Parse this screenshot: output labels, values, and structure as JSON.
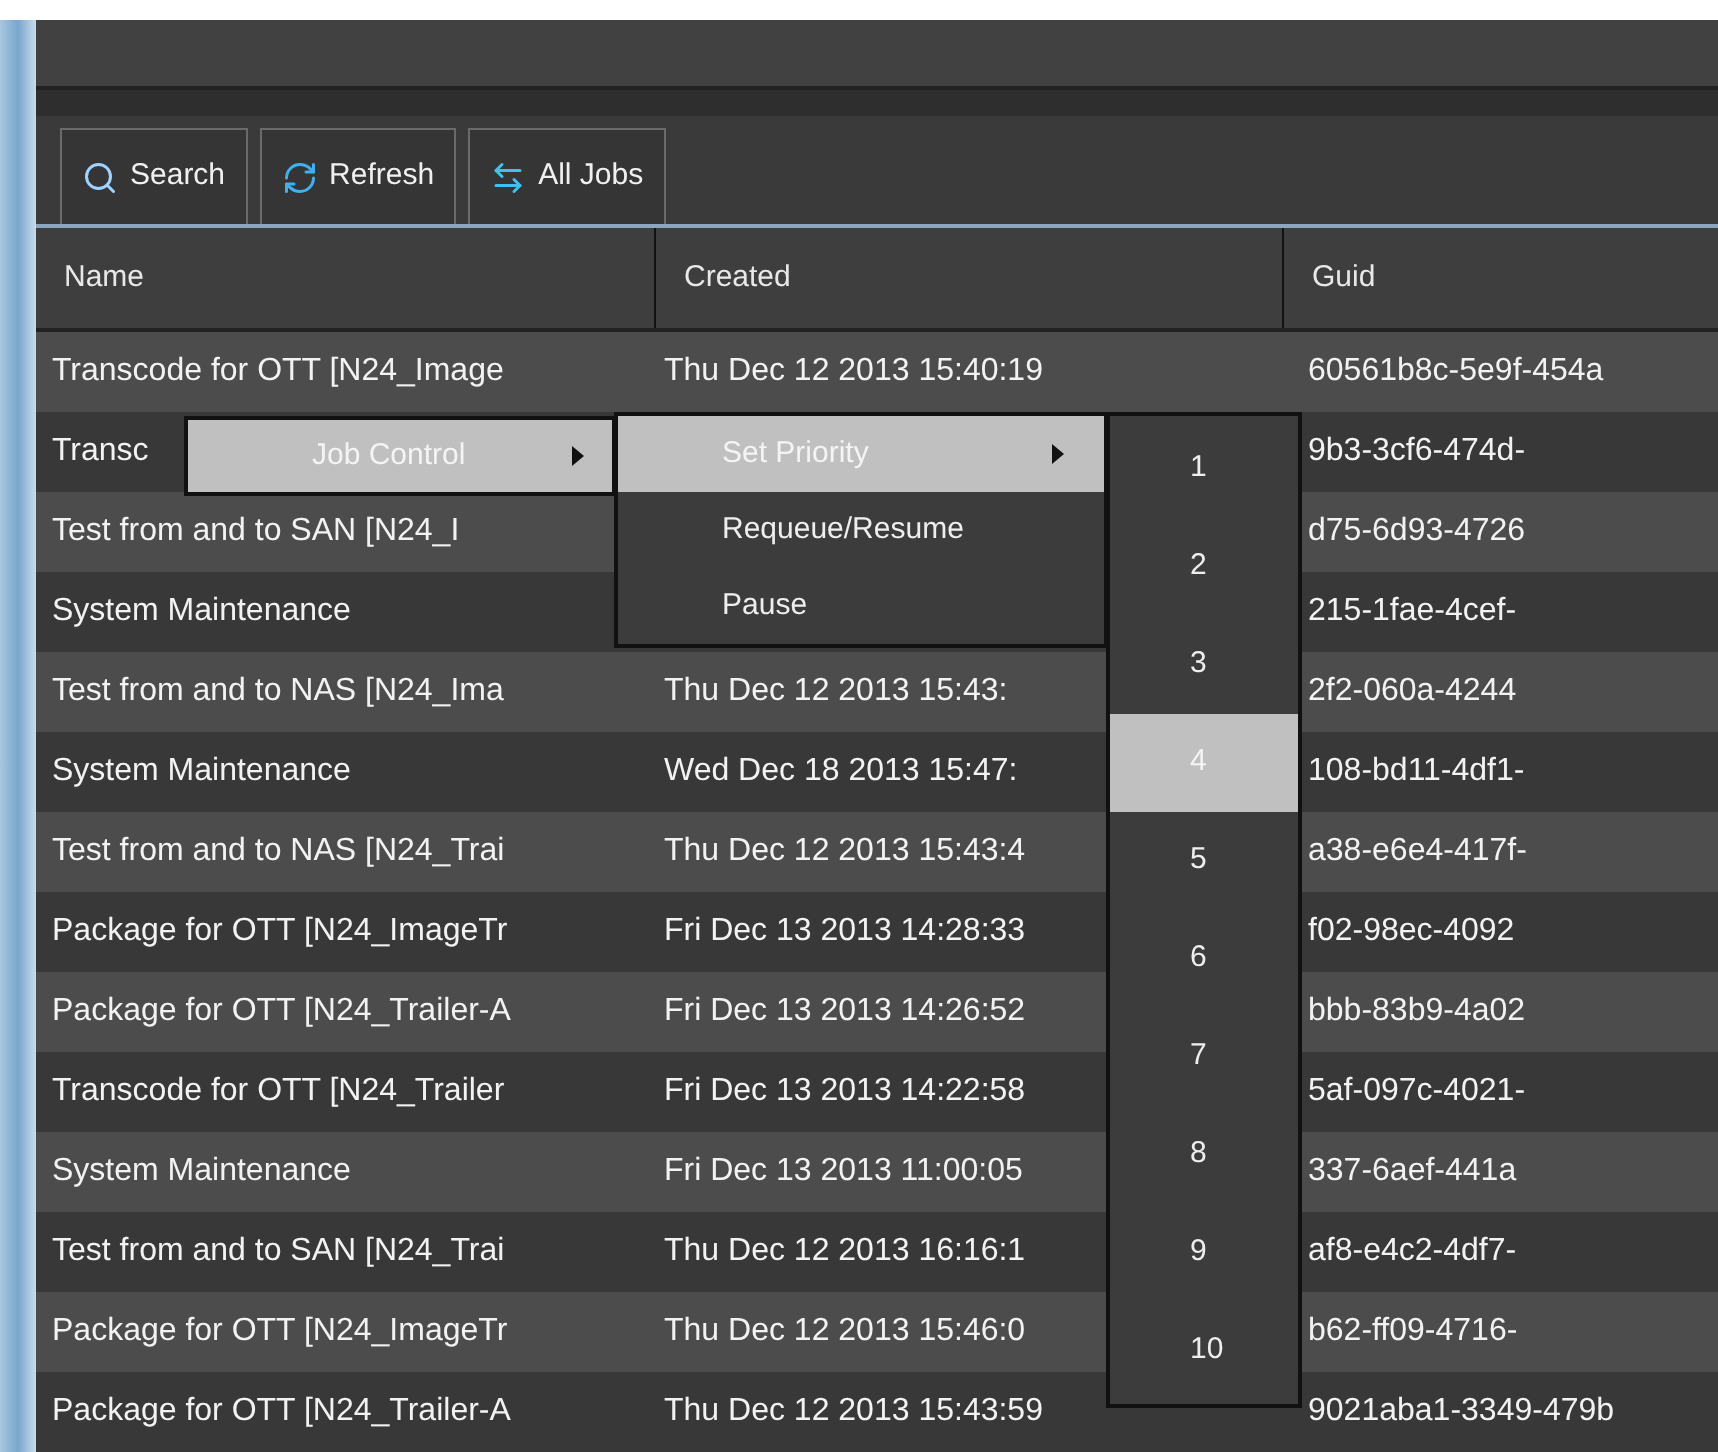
{
  "toolbar": [
    {
      "label": "Search",
      "kind": "search"
    },
    {
      "label": "Refresh",
      "kind": "refresh"
    },
    {
      "label": "All Jobs",
      "kind": "swap"
    }
  ],
  "table": {
    "columns": [
      "Name",
      "Created",
      "Guid"
    ],
    "rows": [
      {
        "name": "Transcode for OTT [N24_Image",
        "created": "Thu Dec 12 2013 15:40:19",
        "guid": "60561b8c-5e9f-454a"
      },
      {
        "name": "Transc",
        "guid": "9b3-3cf6-474d-"
      },
      {
        "name": "Test from and to SAN [N24_I",
        "guid": "d75-6d93-4726"
      },
      {
        "name": "System Maintenance",
        "guid": "215-1fae-4cef-"
      },
      {
        "name": "Test from and to NAS [N24_Ima",
        "created": "Thu Dec 12 2013 15:43:",
        "guid": "2f2-060a-4244"
      },
      {
        "name": "System Maintenance",
        "created": "Wed Dec 18 2013 15:47:",
        "guid": "108-bd11-4df1-"
      },
      {
        "name": "Test from and to NAS [N24_Trai",
        "created": "Thu Dec 12 2013 15:43:4",
        "guid": "a38-e6e4-417f-"
      },
      {
        "name": "Package for OTT [N24_ImageTr",
        "created": "Fri Dec 13 2013 14:28:33",
        "guid": "f02-98ec-4092"
      },
      {
        "name": "Package for OTT [N24_Trailer-A",
        "created": "Fri Dec 13 2013 14:26:52",
        "guid": "bbb-83b9-4a02"
      },
      {
        "name": "Transcode for OTT [N24_Trailer",
        "created": "Fri Dec 13 2013 14:22:58",
        "guid": "5af-097c-4021-"
      },
      {
        "name": "System Maintenance",
        "created": "Fri Dec 13 2013 11:00:05",
        "guid": "337-6aef-441a"
      },
      {
        "name": "Test from and to SAN [N24_Trai",
        "created": "Thu Dec 12 2013 16:16:1",
        "guid": "af8-e4c2-4df7-"
      },
      {
        "name": "Package for OTT [N24_ImageTr",
        "created": "Thu Dec 12 2013 15:46:0",
        "guid": "b62-ff09-4716-"
      },
      {
        "name": "Package for OTT [N24_Trailer-A",
        "created": "Thu Dec 12 2013 15:43:59",
        "guid": "9021aba1-3349-479b"
      }
    ]
  },
  "context_menu": {
    "items": [
      {
        "label": "Job Control",
        "submenu": true,
        "selected": true
      }
    ]
  },
  "job_control_menu": {
    "items": [
      {
        "label": "Set Priority",
        "submenu": true,
        "selected": true
      },
      {
        "label": "Requeue/Resume",
        "submenu": false,
        "selected": false
      },
      {
        "label": "Pause",
        "submenu": false,
        "selected": false
      }
    ]
  },
  "priority_menu": {
    "items": [
      {
        "label": "1",
        "selected": false
      },
      {
        "label": "2",
        "selected": false
      },
      {
        "label": "3",
        "selected": false
      },
      {
        "label": "4",
        "selected": true
      },
      {
        "label": "5",
        "selected": false
      },
      {
        "label": "6",
        "selected": false
      },
      {
        "label": "7",
        "selected": false
      },
      {
        "label": "8",
        "selected": false
      },
      {
        "label": "9",
        "selected": false
      },
      {
        "label": "10",
        "selected": false
      }
    ]
  }
}
